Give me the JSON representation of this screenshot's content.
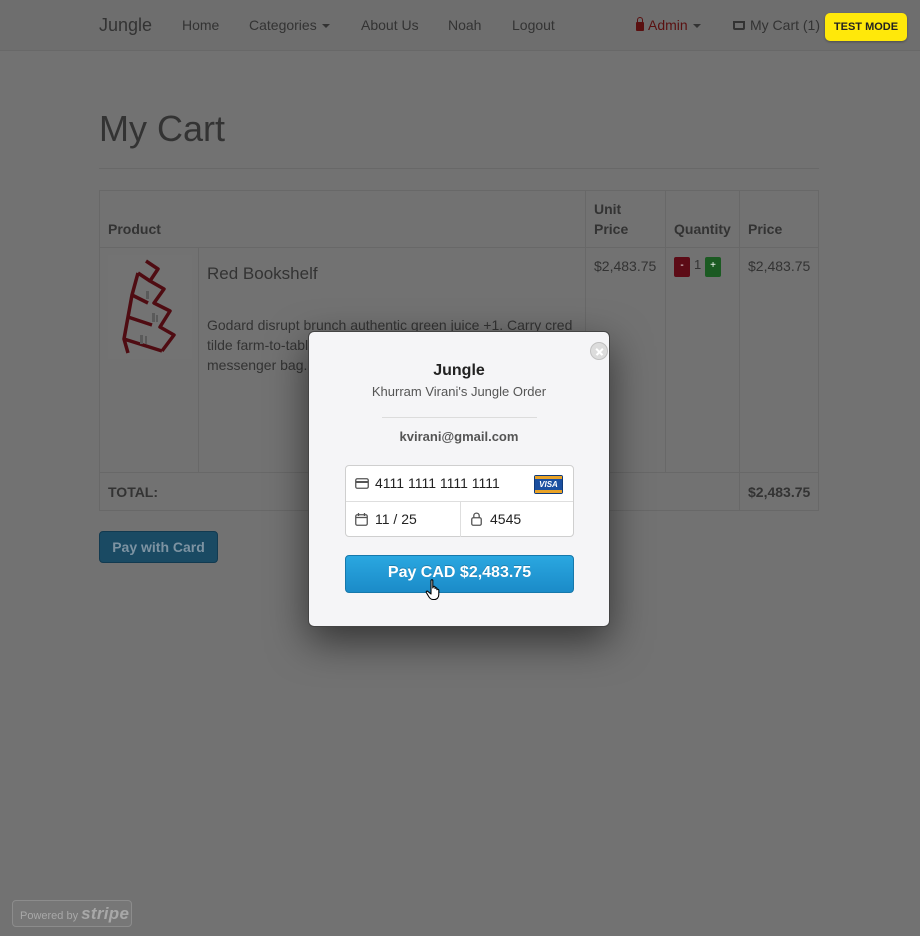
{
  "navbar": {
    "brand": "Jungle",
    "links": {
      "home": "Home",
      "categories": "Categories",
      "about": "About Us",
      "user": "Noah",
      "logout": "Logout"
    },
    "admin_label": "Admin",
    "cart_label": "My Cart (1)",
    "test_mode_label": "TEST MODE"
  },
  "page": {
    "title": "My Cart"
  },
  "table": {
    "headers": {
      "product": "Product",
      "unit_price": "Unit Price",
      "quantity": "Quantity",
      "price": "Price"
    },
    "row": {
      "name": "Red Bookshelf",
      "description": "Godard disrupt brunch authentic green juice +1. Carry cred tilde farm-to-table actually taxiderm Stumptown 8-bit messenger bag. intelligentsia loca wayfarers bespo",
      "unit_price": "$2,483.75",
      "qty_minus": "-",
      "qty": "1",
      "qty_plus": "+",
      "price": "$2,483.75"
    },
    "total_label": "TOTAL:",
    "total_value": "$2,483.75"
  },
  "pay_with_card_label": "Pay with Card",
  "powered_by": {
    "prefix": "Powered by",
    "brand": "stripe"
  },
  "checkout_modal": {
    "title": "Jungle",
    "subtitle": "Khurram Virani's Jungle Order",
    "email": "kvirani@gmail.com",
    "card_number": "4111 1111 1111 1111",
    "card_brand": "VISA",
    "expiry": "11 / 25",
    "cvc": "4545",
    "pay_button_label": "Pay CAD $2,483.75"
  },
  "colors": {
    "overlay_page_bg": "#727272",
    "test_mode_badge": "#ffe80a",
    "pay_button": "#1b8bc8"
  }
}
